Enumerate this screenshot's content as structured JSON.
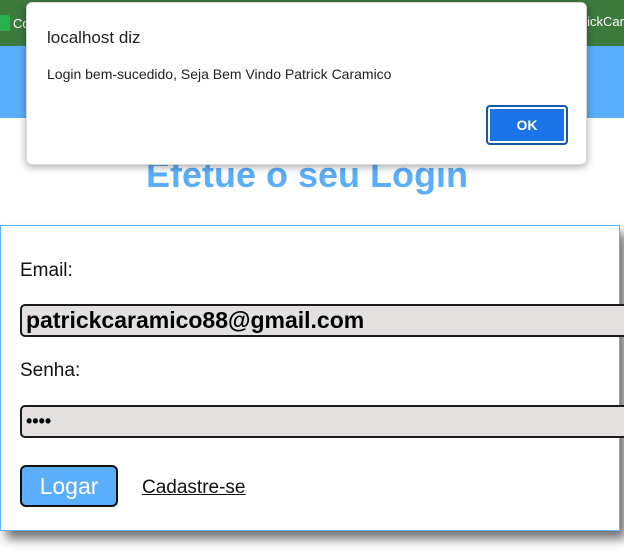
{
  "browser": {
    "tab_left_text": "Co",
    "tab_right_text": "ickCar"
  },
  "page": {
    "title": "Efetue o seu Login"
  },
  "login_form": {
    "email_label": "Email:",
    "email_value": "patrickcaramico88@gmail.com",
    "password_label": "Senha:",
    "password_value": "••••",
    "login_button": "Logar",
    "signup_link": "Cadastre-se"
  },
  "alert": {
    "title": "localhost diz",
    "message": "Login bem-sucedido, Seja Bem Vindo Patrick Caramico",
    "ok_button": "OK"
  },
  "colors": {
    "header": "#5aaefc",
    "title": "#5aaefc",
    "field_bg": "#e4e0df",
    "ok_button": "#1a73e8"
  }
}
